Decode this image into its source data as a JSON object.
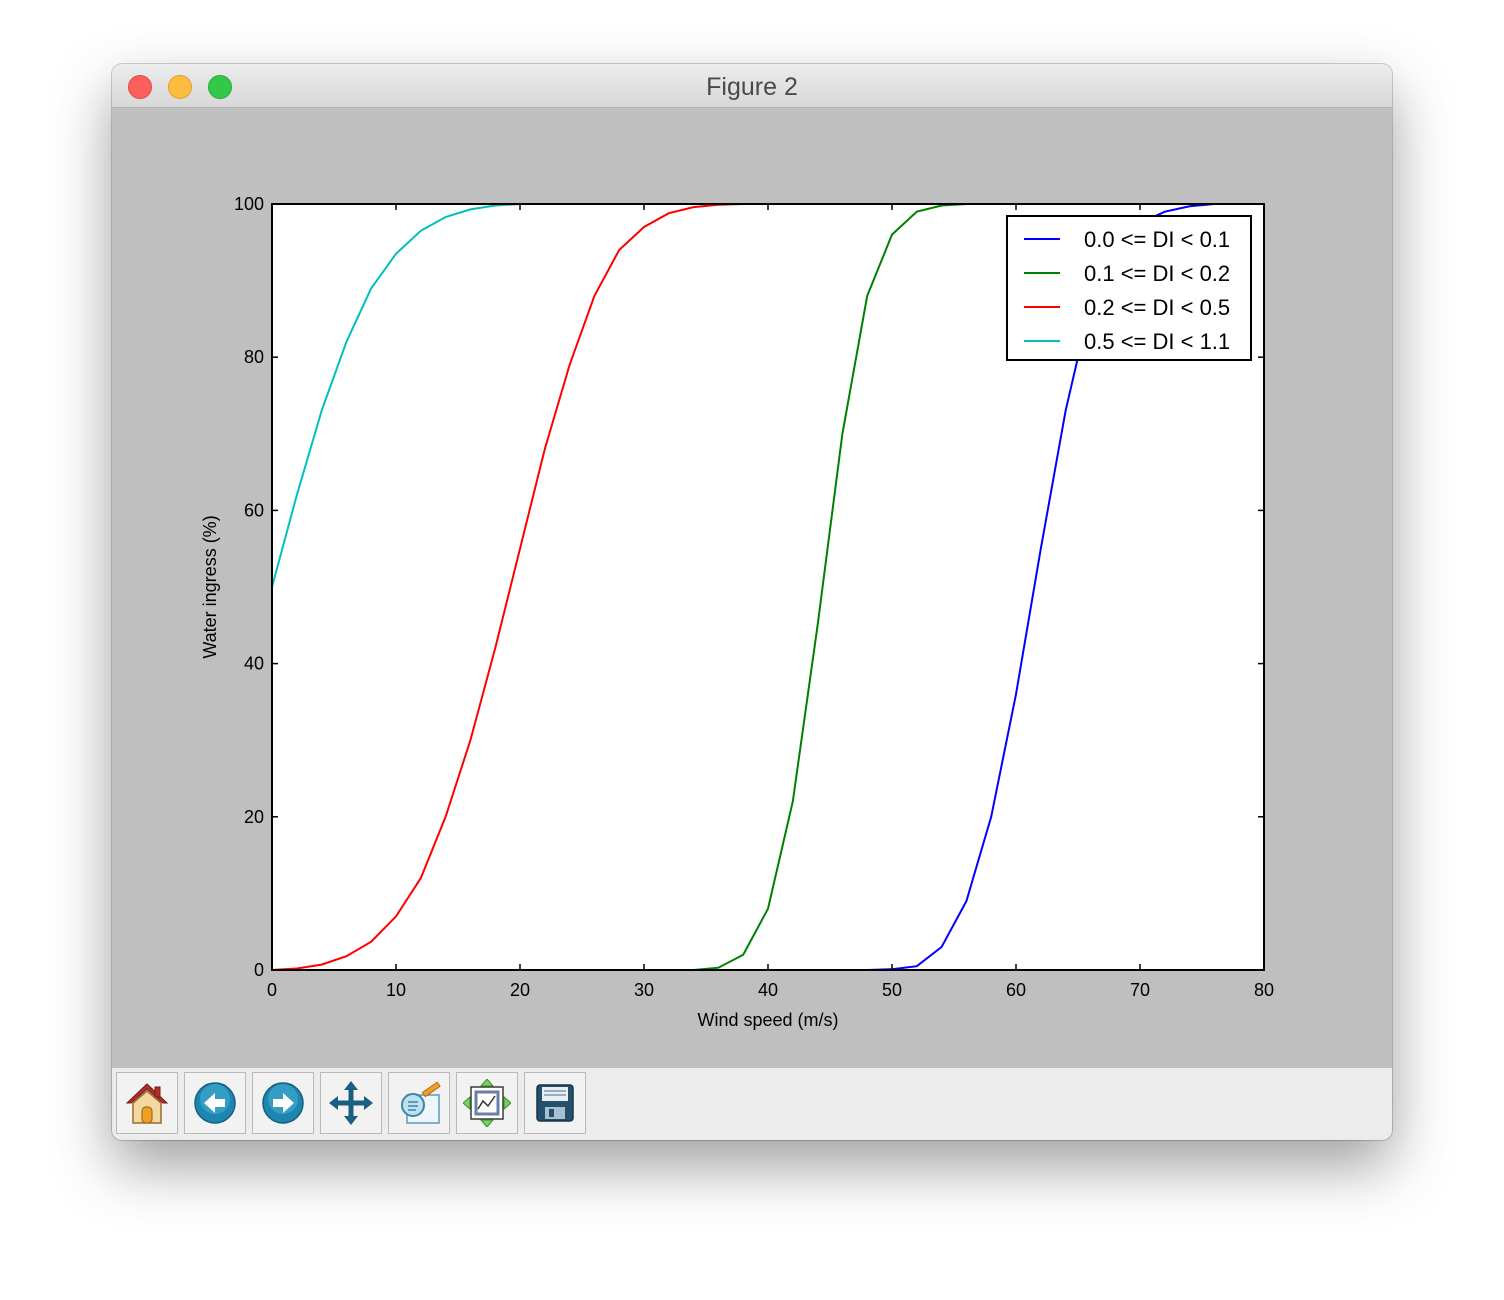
{
  "window": {
    "title": "Figure 2"
  },
  "toolbar": {
    "buttons": [
      {
        "name": "home",
        "icon": "home-icon"
      },
      {
        "name": "back",
        "icon": "back-arrow-icon"
      },
      {
        "name": "forward",
        "icon": "forward-arrow-icon"
      },
      {
        "name": "pan",
        "icon": "move-arrows-icon"
      },
      {
        "name": "zoom",
        "icon": "zoom-rect-icon"
      },
      {
        "name": "subplots",
        "icon": "subplots-config-icon"
      },
      {
        "name": "save",
        "icon": "floppy-disk-icon"
      }
    ]
  },
  "chart_data": {
    "type": "line",
    "title": "",
    "xlabel": "Wind speed (m/s)",
    "ylabel": "Water ingress (%)",
    "xlim": [
      0,
      80
    ],
    "ylim": [
      0,
      100
    ],
    "xticks": [
      "0",
      "10",
      "20",
      "30",
      "40",
      "50",
      "60",
      "70",
      "80"
    ],
    "yticks": [
      "0",
      "20",
      "40",
      "60",
      "80",
      "100"
    ],
    "grid": false,
    "legend_position": "top-right",
    "x": [
      0,
      2,
      4,
      6,
      8,
      10,
      12,
      14,
      16,
      18,
      20,
      22,
      24,
      26,
      28,
      30,
      32,
      34,
      36,
      38,
      40,
      42,
      44,
      46,
      48,
      50,
      52,
      54,
      56,
      58,
      60,
      62,
      64,
      66,
      68,
      70,
      72,
      74,
      76,
      78,
      80
    ],
    "series": [
      {
        "name": "0.0 <= DI < 0.1",
        "color": "#0000ff",
        "values": [
          0,
          0,
          0,
          0,
          0,
          0,
          0,
          0,
          0,
          0,
          0,
          0,
          0,
          0,
          0,
          0,
          0,
          0,
          0,
          0,
          0,
          0,
          0,
          0,
          0,
          0.1,
          0.5,
          3,
          9,
          20,
          36,
          55,
          73,
          87,
          94,
          97.5,
          99,
          99.7,
          100,
          100,
          100
        ]
      },
      {
        "name": "0.1 <= DI < 0.2",
        "color": "#008000",
        "values": [
          0,
          0,
          0,
          0,
          0,
          0,
          0,
          0,
          0,
          0,
          0,
          0,
          0,
          0,
          0,
          0,
          0,
          0,
          0.3,
          2,
          8,
          22,
          45,
          70,
          88,
          96,
          99,
          99.8,
          100,
          100,
          100,
          100,
          100,
          100,
          100,
          100,
          100,
          100,
          100,
          100,
          100
        ]
      },
      {
        "name": "0.2 <= DI < 0.5",
        "color": "#ff0000",
        "values": [
          0,
          0.2,
          0.7,
          1.8,
          3.7,
          7,
          12,
          20,
          30,
          42,
          55,
          68,
          79,
          88,
          94,
          97,
          98.8,
          99.6,
          99.9,
          100,
          100,
          100,
          100,
          100,
          100,
          100,
          100,
          100,
          100,
          100,
          100,
          100,
          100,
          100,
          100,
          100,
          100,
          100,
          100,
          100,
          100
        ]
      },
      {
        "name": "0.5 <= DI < 1.1",
        "color": "#00bfbf",
        "values": [
          50,
          62,
          73,
          82,
          89,
          93.5,
          96.5,
          98.3,
          99.3,
          99.8,
          100,
          100,
          100,
          100,
          100,
          100,
          100,
          100,
          100,
          100,
          100,
          100,
          100,
          100,
          100,
          100,
          100,
          100,
          100,
          100,
          100,
          100,
          100,
          100,
          100,
          100,
          100,
          100,
          100,
          100,
          100
        ]
      }
    ]
  }
}
